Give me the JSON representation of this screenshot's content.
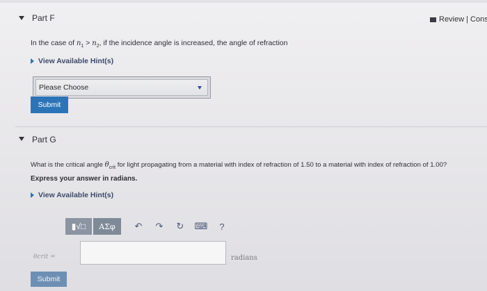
{
  "header": {
    "review_text": "Review | Consta"
  },
  "part_f": {
    "label": "Part F",
    "question": {
      "prefix": "In the case of ",
      "n1": "n",
      "n1_sub": "1",
      "op": " > ",
      "n2": "n",
      "n2_sub": "2",
      "suffix": ", if the incidence angle is increased, the angle of refraction"
    },
    "hint": "View Available Hint(s)",
    "select_value": "Please Choose",
    "submit_label": "Submit"
  },
  "part_g": {
    "label": "Part G",
    "question": {
      "prefix": "What is the critical angle ",
      "theta": "θ",
      "theta_sub": "crit",
      "suffix": " for light propagating from a material with index of refraction of 1.50 to a material with index of refraction of 1.00?"
    },
    "instruction": "Express your answer in radians.",
    "hint": "View Available Hint(s)",
    "toolbar": {
      "matrix_label": "▮√□",
      "greek_label": "ΑΣφ",
      "undo_glyph": "↶",
      "redo_glyph": "↷",
      "reset_glyph": "↻",
      "keyboard_glyph": "⌨",
      "help_glyph": "?"
    },
    "answer_label": "θcrit =",
    "answer_value": "",
    "unit": "radians",
    "submit_label": "Submit"
  },
  "colors": {
    "accent": "#2c74b8",
    "hint_triangle": "#2d73b7"
  }
}
